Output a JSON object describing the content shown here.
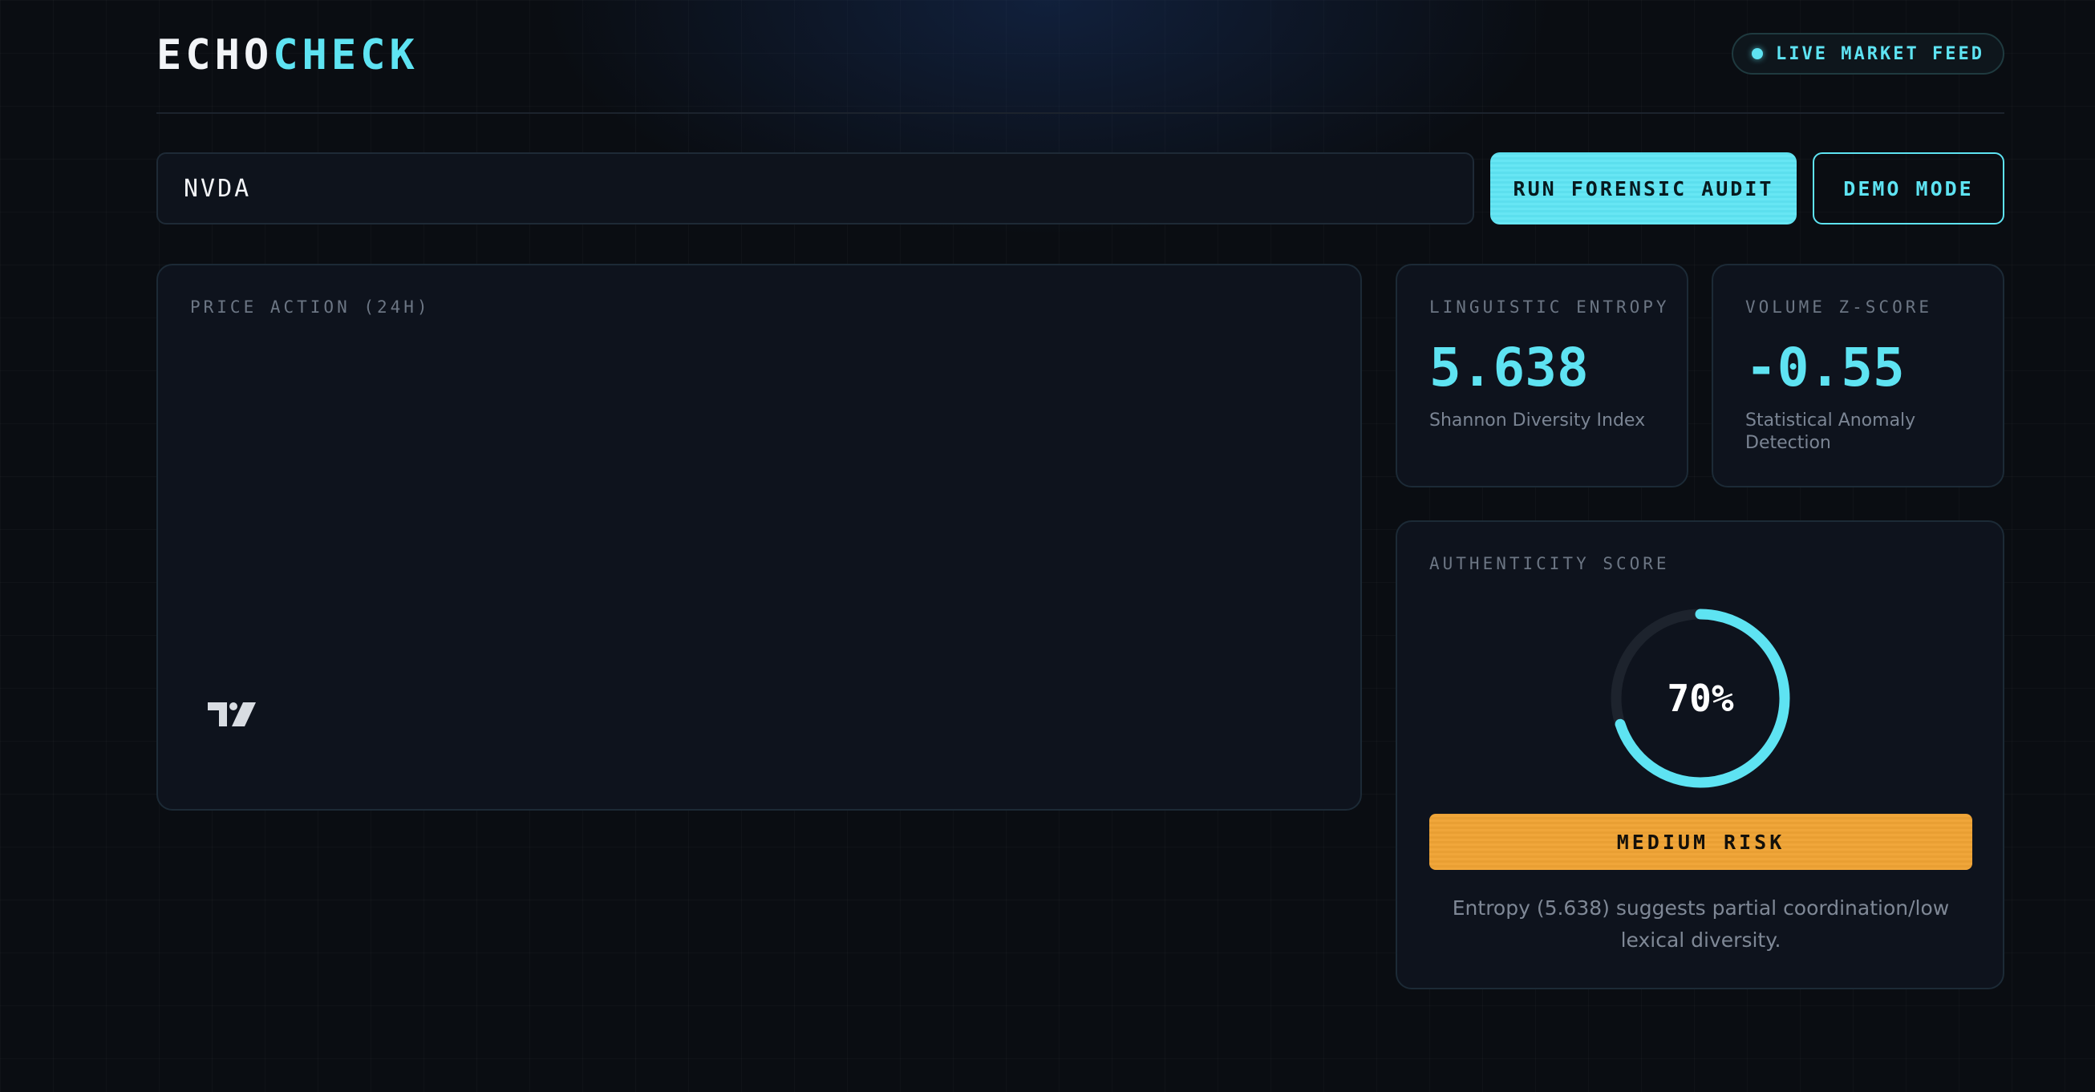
{
  "header": {
    "logo_part1": "ECHO",
    "logo_part2": "CHECK",
    "live_badge_label": "LIVE MARKET FEED"
  },
  "search": {
    "value": "NVDA"
  },
  "toolbar": {
    "audit_label": "RUN FORENSIC AUDIT",
    "demo_label": "DEMO MODE"
  },
  "chart_panel": {
    "label": "PRICE ACTION (24H)",
    "widget_logo_icon": "tradingview-logo-icon"
  },
  "metrics": {
    "entropy": {
      "label": "LINGUISTIC ENTROPY",
      "value": "5.638",
      "description": "Shannon Diversity Index"
    },
    "zscore": {
      "label": "VOLUME Z-SCORE",
      "value": "-0.55",
      "description": "Statistical Anomaly Detection"
    }
  },
  "authenticity": {
    "label": "AUTHENTICITY SCORE",
    "score_text": "70%",
    "score_fraction": 0.7,
    "risk_label": "MEDIUM RISK",
    "risk_color": "#f0a63a",
    "note": "Entropy (5.638) suggests partial coordination/low lexical diversity."
  },
  "colors": {
    "accent": "#5ee3f2",
    "background": "#0a0d12",
    "card": "#0e131d",
    "warning": "#f0a63a"
  }
}
